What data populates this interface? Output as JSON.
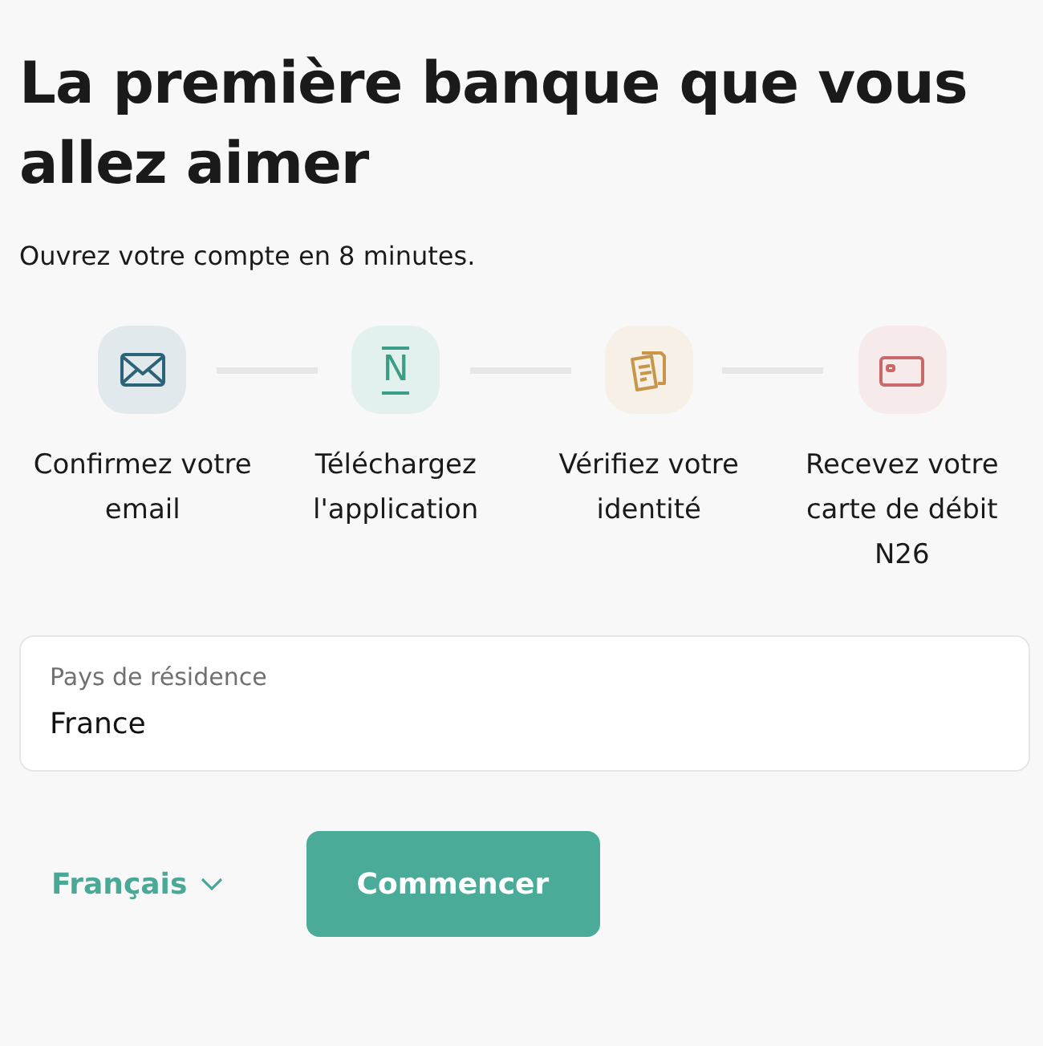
{
  "title": "La première banque que vous allez aimer",
  "subtitle": "Ouvrez votre compte en 8 minutes.",
  "steps": [
    {
      "kind": "email",
      "color": "#2b6478",
      "label": "Confirmez votre email"
    },
    {
      "kind": "app",
      "color": "#3a9e86",
      "icon_text": "N",
      "label": "Téléchargez l'application"
    },
    {
      "kind": "documents",
      "color": "#c8964a",
      "label": "Vérifiez votre identité"
    },
    {
      "kind": "card",
      "color": "#c96a6a",
      "label": "Recevez votre carte de débit N26"
    }
  ],
  "country_field": {
    "label": "Pays de résidence",
    "value": "France"
  },
  "language": "Français",
  "start_button": "Commencer"
}
